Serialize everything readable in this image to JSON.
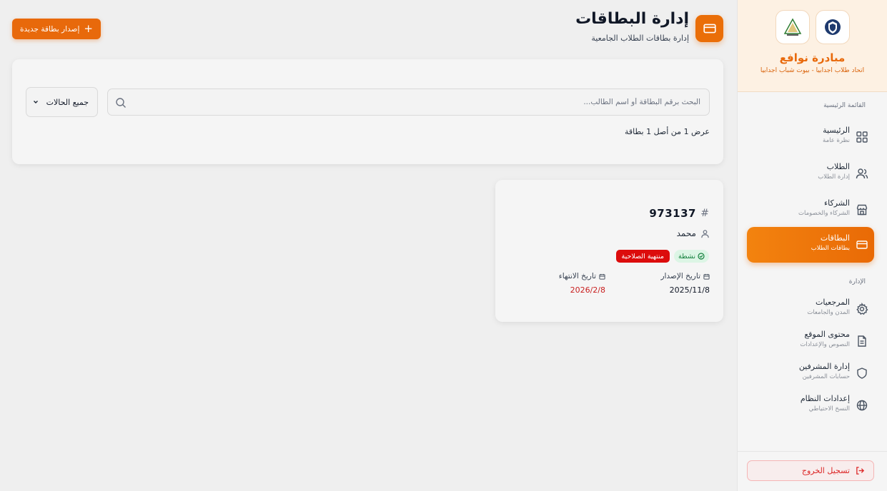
{
  "brand": {
    "title": "مبادرة نوافع",
    "subtitle": "اتحاد طلاب اجدابيا - بيوت شباب اجدابيا"
  },
  "sidebar": {
    "main_section_title": "القائمة الرئيسية",
    "admin_section_title": "الإدارة",
    "items": [
      {
        "label": "الرئيسية",
        "sub": "نظرة عامة",
        "icon": "grid-icon"
      },
      {
        "label": "الطلاب",
        "sub": "إدارة الطلاب",
        "icon": "users-icon"
      },
      {
        "label": "الشركاء",
        "sub": "الشركاء والخصومات",
        "icon": "store-icon"
      },
      {
        "label": "البطاقات",
        "sub": "بطاقات الطلاب",
        "icon": "card-icon",
        "active": true
      },
      {
        "label": "المرجعيات",
        "sub": "المدن والجامعات",
        "icon": "gear-icon"
      },
      {
        "label": "محتوى الموقع",
        "sub": "النصوص والإعدادات",
        "icon": "document-icon"
      },
      {
        "label": "إدارة المشرفين",
        "sub": "حسابات المشرفين",
        "icon": "shield-icon"
      },
      {
        "label": "إعدادات النظام",
        "sub": "النسخ الاحتياطي",
        "icon": "globe-icon"
      }
    ],
    "logout_label": "تسجيل الخروج"
  },
  "header": {
    "title": "إدارة البطاقات",
    "subtitle": "إدارة بطاقات الطلاب الجامعية",
    "issue_button_label": "إصدار بطاقة جديدة"
  },
  "filters": {
    "search_placeholder": "البحث برقم البطاقة أو اسم الطالب...",
    "search_value": "",
    "status_selected": "جميع الحالات",
    "count_text": "عرض 1 من أصل 1 بطاقة"
  },
  "cards": [
    {
      "number": "973137",
      "student_name": "محمد",
      "badge_active": "نشطة",
      "badge_expired": "منتهية الصلاحية",
      "issue_label": "تاريخ الإصدار",
      "issue_date": "2025/11/8",
      "expiry_label": "تاريخ الانتهاء",
      "expiry_date": "2026/2/8"
    }
  ],
  "colors": {
    "accent": "#e8690b",
    "danger": "#dc0c0c",
    "success": "#15803d"
  }
}
